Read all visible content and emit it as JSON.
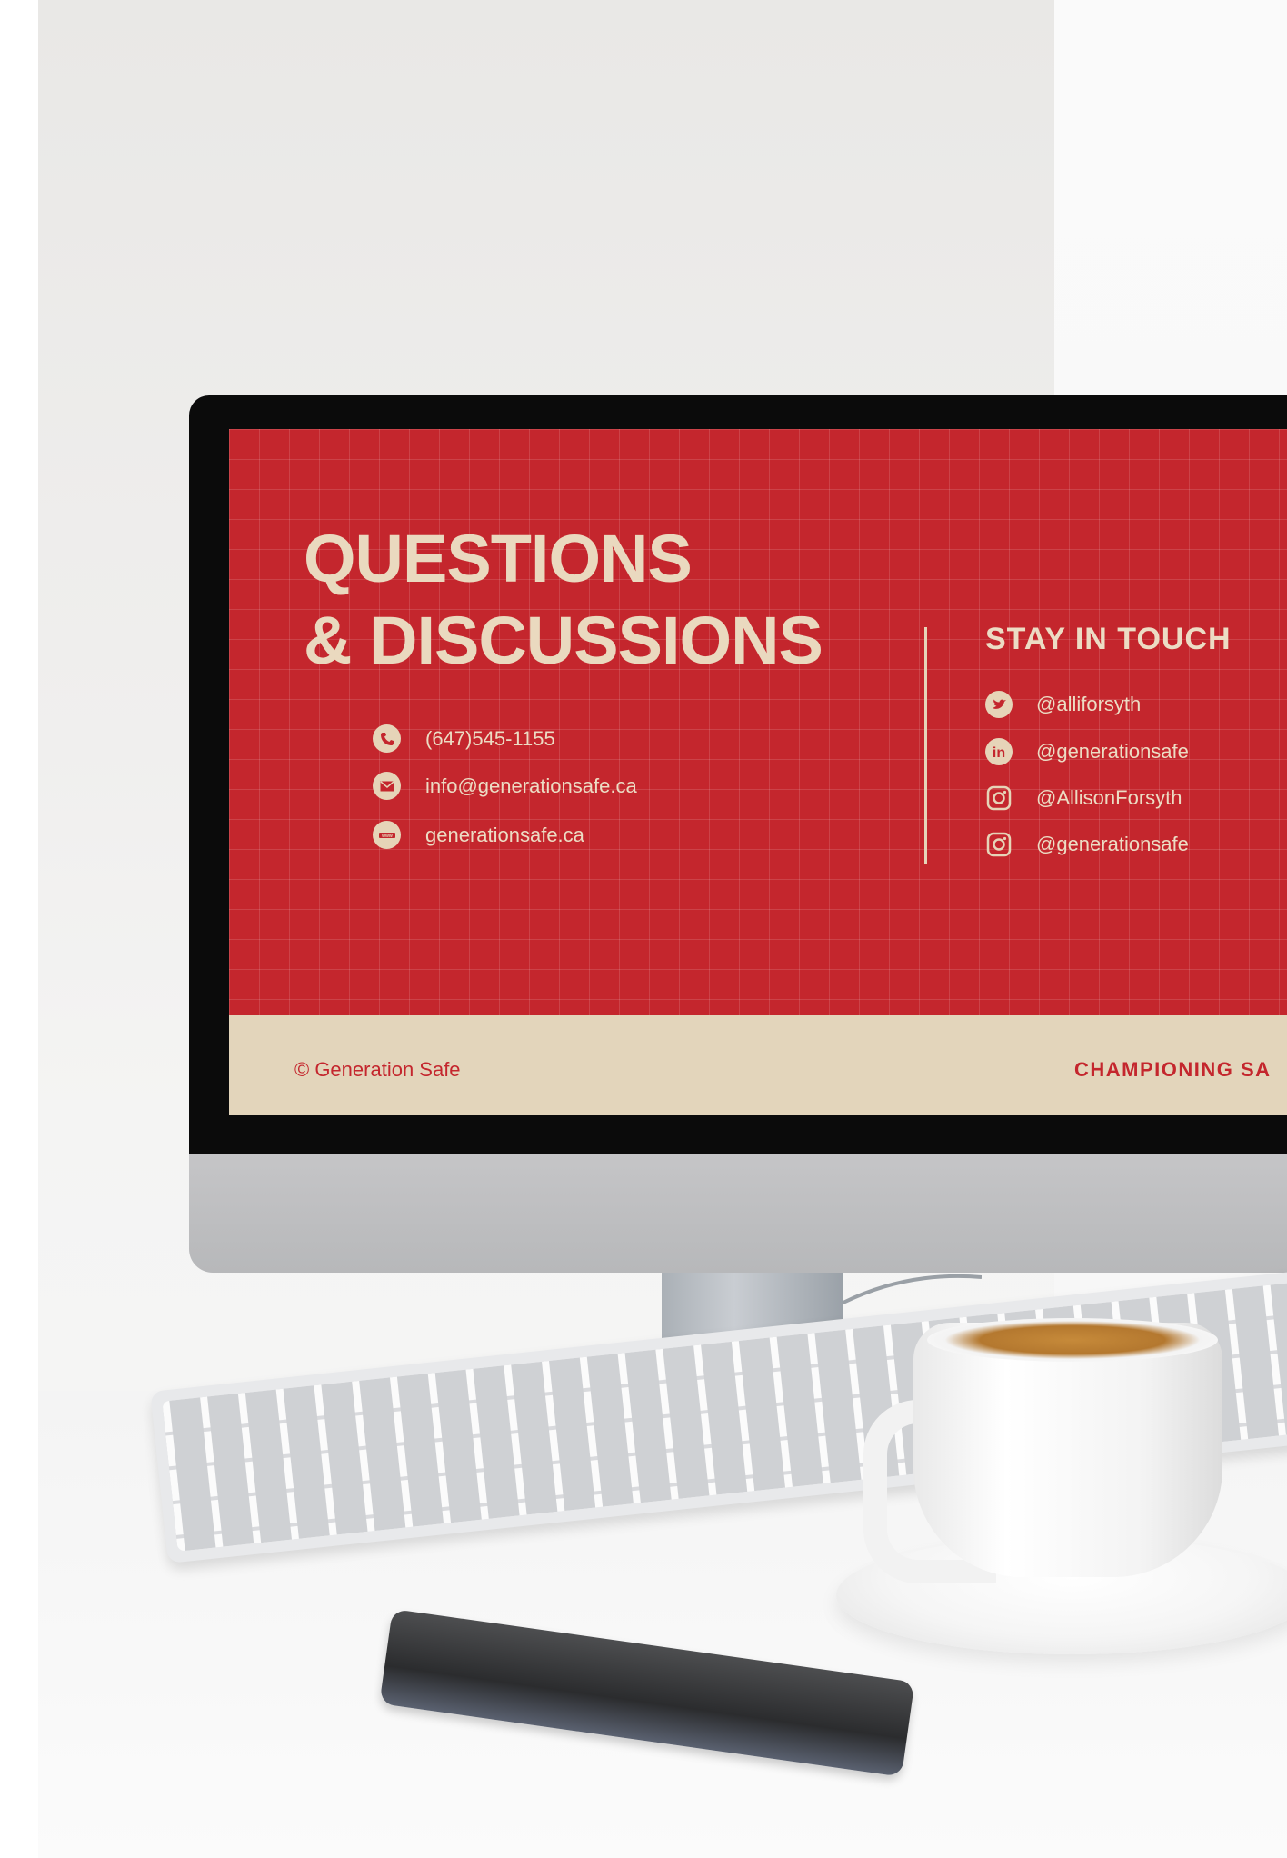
{
  "slide": {
    "title_lines": [
      "QUESTIONS",
      "& DISCUSSIONS"
    ],
    "contacts": [
      {
        "icon": "phone-icon",
        "text": "(647)545-1155"
      },
      {
        "icon": "email-icon",
        "text": "info@generationsafe.ca"
      },
      {
        "icon": "web-icon",
        "text": "generationsafe.ca"
      }
    ],
    "stay_in_touch": {
      "heading": "STAY IN TOUCH",
      "items": [
        {
          "icon": "twitter-icon",
          "text": "@alliforsyth"
        },
        {
          "icon": "linkedin-icon",
          "text": "@generationsafe"
        },
        {
          "icon": "instagram-icon",
          "text": "@AllisonForsyth"
        },
        {
          "icon": "instagram-icon",
          "text": "@generationsafe"
        }
      ]
    },
    "footer": {
      "left": "© Generation Safe",
      "right": "CHAMPIONING SA"
    }
  },
  "colors": {
    "slide_red": "#c4262d",
    "slide_cream": "#e3d5bb",
    "title_cream": "#ead9bf",
    "monitor_bezel": "#0b0b0b",
    "monitor_chin": "#bfc0c2"
  },
  "scene_objects": [
    "monitor",
    "keyboard",
    "coffee-cup",
    "saucer",
    "smartphone",
    "cable"
  ]
}
